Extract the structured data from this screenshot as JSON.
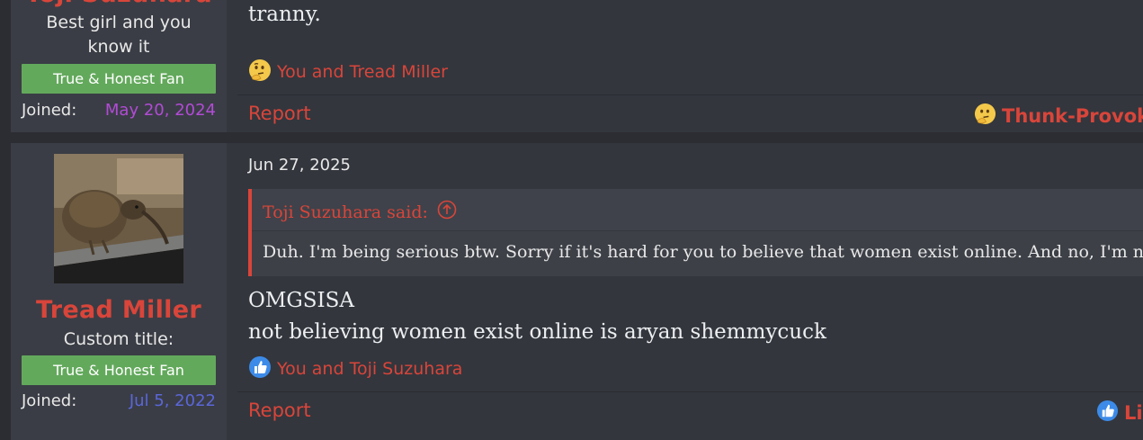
{
  "posts": [
    {
      "author": {
        "name": "Toji Suzuhara",
        "title": "Best girl and you know it",
        "banner": "True & Honest Fan",
        "joined_label": "Joined:",
        "joined_value": "May 20, 2024",
        "joined_color": "#b24bd6"
      },
      "body_lines": [
        "tranny."
      ],
      "reactions_text": "You and Tread Miller",
      "reaction_icon": "thinking-face-icon",
      "footer": {
        "report_label": "Report",
        "reaction_button_label": "Thunk-Provoking"
      }
    },
    {
      "author": {
        "name": "Tread Miller",
        "title": "Custom title:",
        "banner": "True & Honest Fan",
        "joined_label": "Joined:",
        "joined_value": "Jul 5, 2022",
        "joined_color": "#5b67d9"
      },
      "date": "Jun 27, 2025",
      "quote": {
        "author_label": "Toji Suzuhara said:",
        "text": "Duh. I'm being serious btw. Sorry if it's hard for you to believe that women exist online. And no, I'm not"
      },
      "body_lines": [
        "OMGSISA",
        "not believing women exist online is aryan shemmycuck"
      ],
      "reactions_text": "You and Toji Suzuhara",
      "reaction_icon": "thumbs-up-icon",
      "footer": {
        "report_label": "Report",
        "reaction_button_label": "Like"
      }
    }
  ],
  "colors": {
    "page_bg": "#2b2d33",
    "post_bg": "#33363d",
    "user_panel_bg": "#3a3d45",
    "accent_red": "#d9453a",
    "banner_green": "#63a95c"
  }
}
